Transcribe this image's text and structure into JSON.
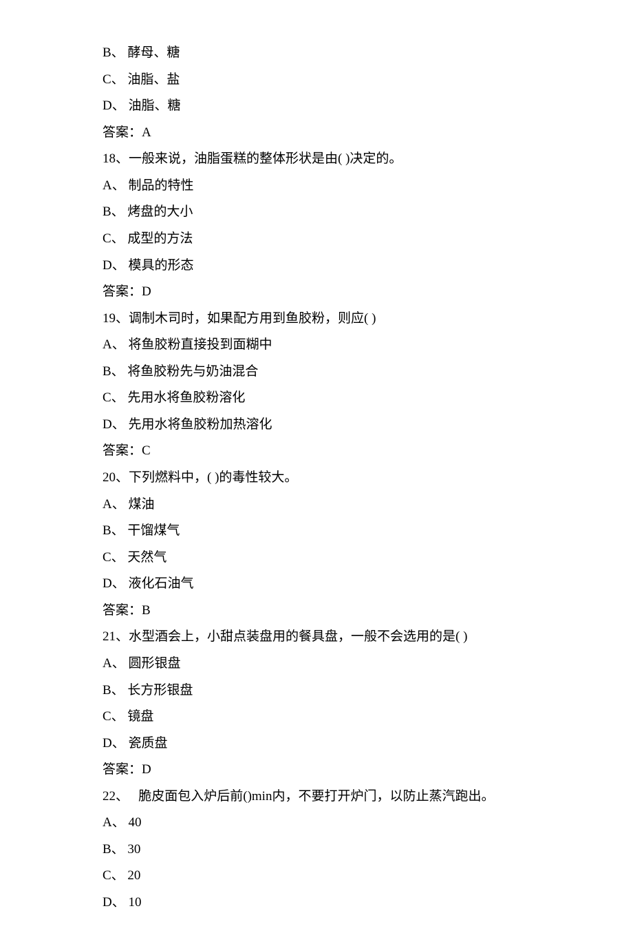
{
  "lines": [
    "B、 酵母、糖",
    "C、 油脂、盐",
    "D、 油脂、糖",
    "答案：A",
    "18、一般来说，油脂蛋糕的整体形状是由( )决定的。",
    "A、 制品的特性",
    "B、 烤盘的大小",
    "C、 成型的方法",
    "D、 模具的形态",
    "答案：D",
    "19、调制木司时，如果配方用到鱼胶粉，则应( )",
    "A、 将鱼胶粉直接投到面糊中",
    "B、 将鱼胶粉先与奶油混合",
    "C、 先用水将鱼胶粉溶化",
    "D、 先用水将鱼胶粉加热溶化",
    "答案：C",
    "20、下列燃料中，( )的毒性较大。",
    "A、 煤油",
    "B、 干馏煤气",
    "C、 天然气",
    "D、 液化石油气",
    "答案：B",
    "21、水型酒会上，小甜点装盘用的餐具盘，一般不会选用的是( )",
    "A、 圆形银盘",
    "B、 长方形银盘",
    "C、 镜盘",
    "D、 瓷质盘",
    "答案：D",
    "22、   脆皮面包入炉后前()min内，不要打开炉门，以防止蒸汽跑出。",
    "A、 40",
    "B、 30",
    "C、 20",
    "D、 10"
  ]
}
